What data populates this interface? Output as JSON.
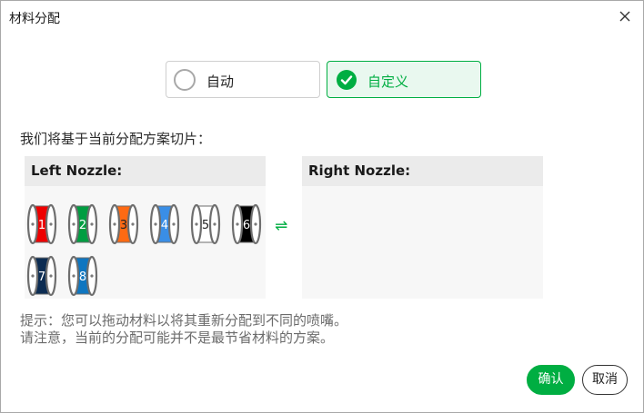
{
  "dialog": {
    "title": "材料分配"
  },
  "mode": {
    "auto_label": "自动",
    "custom_label": "自定义",
    "selected": "custom"
  },
  "description": "我们将基于当前分配方案切片：",
  "left_panel": {
    "title": "Left Nozzle:",
    "spools": [
      {
        "id": "1",
        "color": "#ee0000",
        "text_color": "#ffffff"
      },
      {
        "id": "2",
        "color": "#009d41",
        "text_color": "#ffffff"
      },
      {
        "id": "3",
        "color": "#ff6a13",
        "text_color": "#222222"
      },
      {
        "id": "4",
        "color": "#3a8ee6",
        "text_color": "#ffffff"
      },
      {
        "id": "5",
        "color": "#ffffff",
        "text_color": "#222222"
      },
      {
        "id": "6",
        "color": "#000000",
        "text_color": "#ffffff"
      },
      {
        "id": "7",
        "color": "#0c2c52",
        "text_color": "#ffffff"
      },
      {
        "id": "8",
        "color": "#0f76c0",
        "text_color": "#ffffff"
      }
    ]
  },
  "right_panel": {
    "title": "Right Nozzle:"
  },
  "swap_icon": "swap-arrows-icon",
  "tip": {
    "line1": "提示：您可以拖动材料以将其重新分配到不同的喷嘴。",
    "line2": "请注意，当前的分配可能并不是最节省材料的方案。"
  },
  "buttons": {
    "confirm": "确认",
    "cancel": "取消"
  },
  "colors": {
    "accent": "#00ae42",
    "panel_bg": "#f7f7f7",
    "panel_header": "#ebebeb"
  }
}
